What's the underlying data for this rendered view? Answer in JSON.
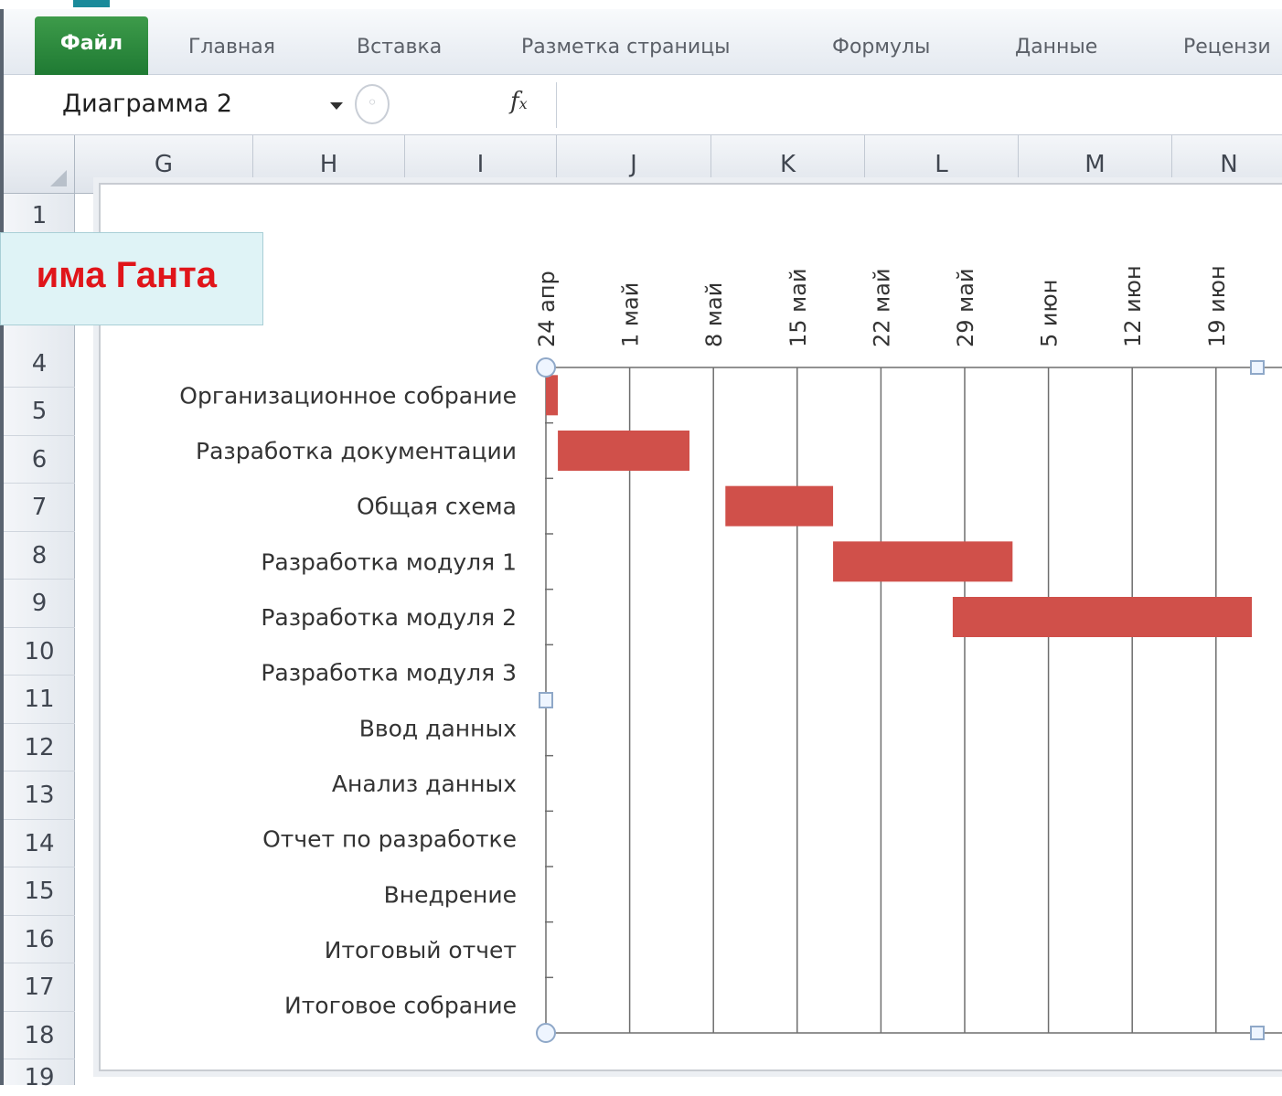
{
  "ribbon": {
    "tabs": [
      "Файл",
      "Главная",
      "Вставка",
      "Разметка страницы",
      "Формулы",
      "Данные",
      "Рецензи"
    ]
  },
  "formula_bar": {
    "name_box": "Диаграмма 2",
    "fx_label": "fx",
    "content": ""
  },
  "columns": [
    "G",
    "H",
    "I",
    "J",
    "K",
    "L",
    "M",
    "N"
  ],
  "rows": [
    "1",
    "4",
    "5",
    "6",
    "7",
    "8",
    "9",
    "10",
    "11",
    "12",
    "13",
    "14",
    "15",
    "16",
    "17",
    "18",
    "19"
  ],
  "overlay": {
    "title": "има Ганта"
  },
  "chart_data": {
    "type": "bar",
    "subtype": "gantt (horizontal stacked bar, date axis on top)",
    "categories": [
      "Организационное собрание",
      "Разработка документации",
      "Общая схема",
      "Разработка модуля 1",
      "Разработка модуля 2",
      "Разработка модуля 3",
      "Ввод данных",
      "Анализ данных",
      "Отчет по разработке",
      "Внедрение",
      "Итоговый отчет",
      "Итоговое собрание"
    ],
    "x_ticks": [
      "24 апр",
      "1 май",
      "8 май",
      "15 май",
      "22 май",
      "29 май",
      "5 июн",
      "12 июн",
      "19 июн"
    ],
    "xlim": [
      "24 апр",
      "26 июн"
    ],
    "bars": [
      {
        "task": "Организационное собрание",
        "start": "24 апр",
        "end": "25 апр"
      },
      {
        "task": "Разработка документации",
        "start": "25 апр",
        "end": "6 май"
      },
      {
        "task": "Общая схема",
        "start": "9 май",
        "end": "18 май"
      },
      {
        "task": "Разработка модуля 1",
        "start": "18 май",
        "end": "2 июн"
      },
      {
        "task": "Разработка модуля 2",
        "start": "28 май",
        "end": "22 июн"
      }
    ],
    "bar_color": "#d0504a",
    "grid": "vertical gridlines at each tick",
    "legend": "none",
    "title": ""
  }
}
